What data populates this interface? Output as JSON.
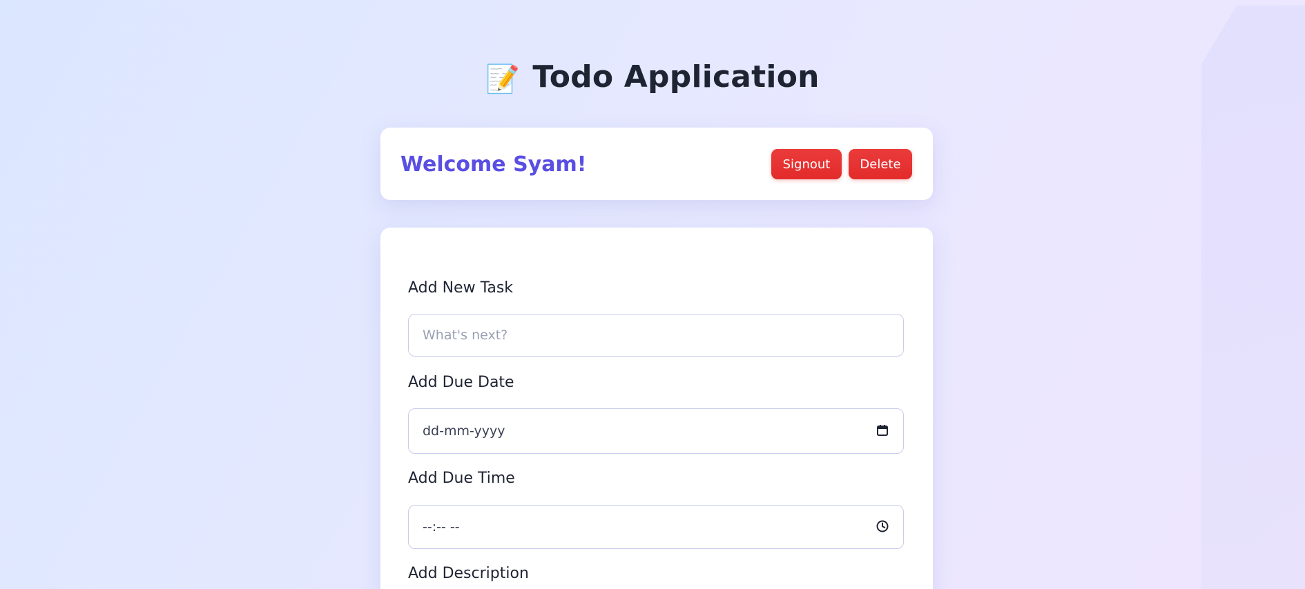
{
  "app": {
    "title": "Todo Application",
    "title_icon": "📝"
  },
  "welcome": {
    "text": "Welcome Syam!",
    "signout_label": "Signout",
    "delete_label": "Delete"
  },
  "form": {
    "task_label": "Add New Task",
    "task_placeholder": "What's next?",
    "date_label": "Add Due Date",
    "date_value": "dd-mm-yyyy",
    "date_icon": "📅",
    "time_label": "Add Due Time",
    "time_value": "--:-- --",
    "time_icon": "⏱",
    "description_label": "Add Description"
  },
  "colors": {
    "accent": "#5a4fe3",
    "danger": "#e32b2b",
    "text": "#1f2433"
  }
}
